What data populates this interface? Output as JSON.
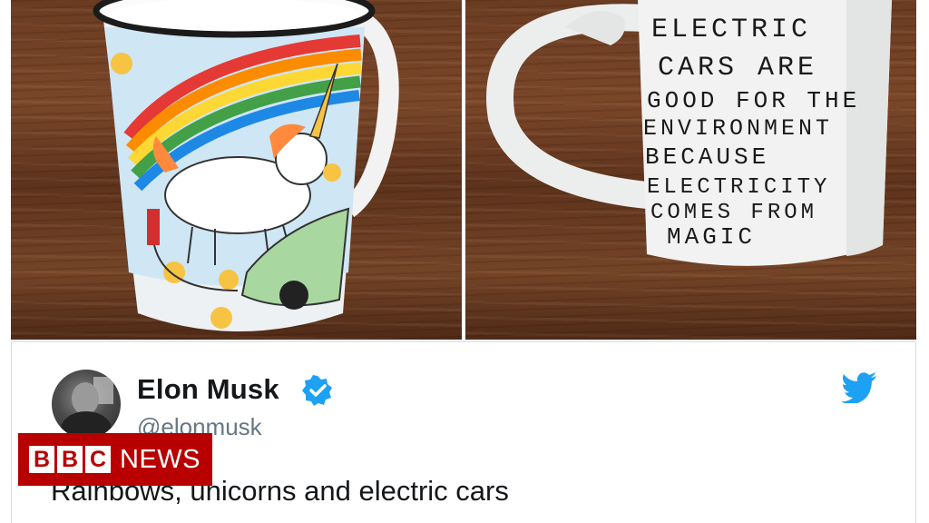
{
  "photos": {
    "left_mug": {
      "description_icon": "unicorn-rainbow-mug"
    },
    "right_mug": {
      "lines": [
        "ELECTRIC",
        "CARS ARE",
        "GOOD FOR THE",
        "ENVIRONMENT",
        "BECAUSE",
        "ELECTRICITY",
        "COMES FROM",
        "MAGIC"
      ]
    }
  },
  "tweet": {
    "name": "Elon Musk",
    "handle": "@elonmusk",
    "text": "Rainbows, unicorns and electric cars",
    "verified_icon": "verified-badge-icon",
    "brand_icon": "twitter-bird-icon",
    "accent_color": "#1da1f2"
  },
  "watermark": {
    "letters": [
      "B",
      "B",
      "C"
    ],
    "label": "NEWS",
    "color": "#b80000"
  }
}
